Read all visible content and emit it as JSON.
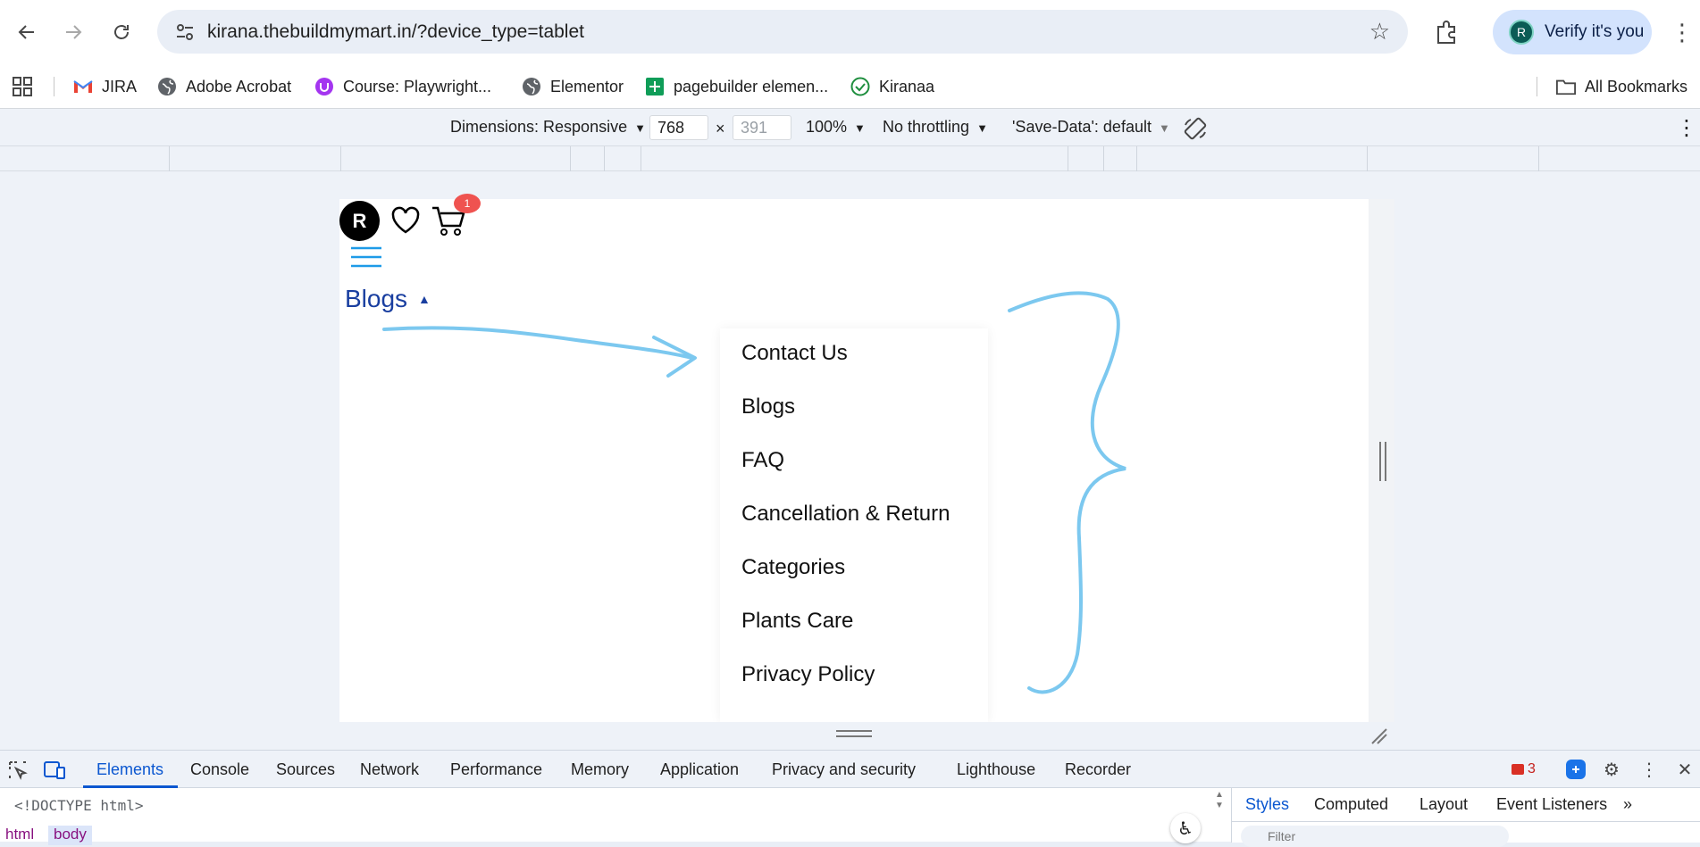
{
  "browser": {
    "url": "kirana.thebuildmymart.in/?device_type=tablet",
    "profile_initial": "R",
    "verify_label": "Verify it's you"
  },
  "bookmarks": [
    {
      "label": "JIRA",
      "icon": "gmail-icon"
    },
    {
      "label": "Adobe Acrobat",
      "icon": "globe-icon"
    },
    {
      "label": "Course: Playwright...",
      "icon": "udemy-icon"
    },
    {
      "label": "Elementor",
      "icon": "globe-icon"
    },
    {
      "label": "pagebuilder elemen...",
      "icon": "sheets-icon"
    },
    {
      "label": "Kiranaa",
      "icon": "check-circle-icon"
    }
  ],
  "all_bookmarks_label": "All Bookmarks",
  "device_toolbar": {
    "dimensions_label": "Dimensions: Responsive",
    "width": "768",
    "height_placeholder": "391",
    "times": "×",
    "zoom": "100%",
    "throttling": "No throttling",
    "save_data": "'Save-Data': default"
  },
  "site": {
    "avatar_initial": "R",
    "cart_badge": "1",
    "nav_link": "Blogs",
    "menu_items": [
      "Contact Us",
      "Blogs",
      "FAQ",
      "Cancellation & Return",
      "Categories",
      "Plants Care",
      "Privacy Policy"
    ],
    "accent_color": "#1a3fa0",
    "annotation_color": "#7cc8ef"
  },
  "devtools": {
    "tabs": [
      "Elements",
      "Console",
      "Sources",
      "Network",
      "Performance",
      "Memory",
      "Application",
      "Privacy and security",
      "Lighthouse",
      "Recorder"
    ],
    "active_tab": "Elements",
    "error_count": "3",
    "doctype": "<!DOCTYPE html>",
    "breadcrumbs": [
      "html",
      "body"
    ],
    "styles_tabs": [
      "Styles",
      "Computed",
      "Layout",
      "Event Listeners"
    ],
    "styles_more": "»",
    "filter_placeholder": "Filter"
  }
}
